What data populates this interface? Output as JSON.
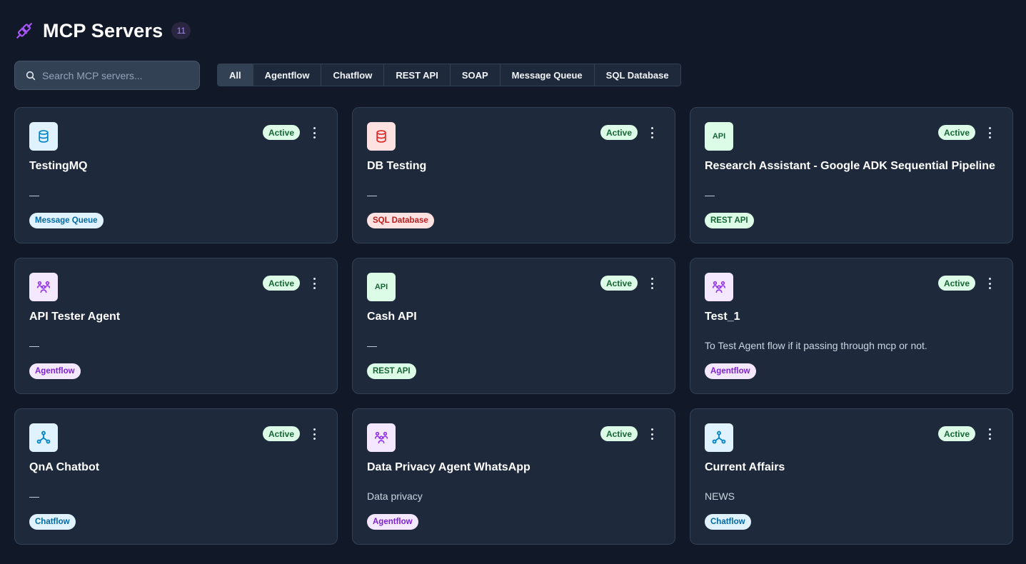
{
  "header": {
    "title": "MCP Servers",
    "count": "11",
    "logo_icon": "plug-icon"
  },
  "search": {
    "placeholder": "Search MCP servers...",
    "value": ""
  },
  "filters": [
    "All",
    "Agentflow",
    "Chatflow",
    "REST API",
    "SOAP",
    "Message Queue",
    "SQL Database"
  ],
  "active_filter": "All",
  "cards": [
    {
      "title": "TestingMQ",
      "desc": "—",
      "tag": "Message Queue",
      "status": "Active",
      "kind": "mq",
      "icon": "database-icon"
    },
    {
      "title": "DB Testing",
      "desc": "—",
      "tag": "SQL Database",
      "status": "Active",
      "kind": "sql",
      "icon": "database-icon"
    },
    {
      "title": "Research Assistant - Google ADK Sequential Pipeline",
      "desc": "—",
      "tag": "REST API",
      "status": "Active",
      "kind": "api",
      "icon": "api-icon",
      "icon_text": "API"
    },
    {
      "title": "API Tester Agent",
      "desc": "—",
      "tag": "Agentflow",
      "status": "Active",
      "kind": "agent",
      "icon": "users-icon"
    },
    {
      "title": "Cash API",
      "desc": "—",
      "tag": "REST API",
      "status": "Active",
      "kind": "api",
      "icon": "api-icon",
      "icon_text": "API"
    },
    {
      "title": "Test_1",
      "desc": "To Test Agent flow if it passing through mcp or not.",
      "tag": "Agentflow",
      "status": "Active",
      "kind": "agent",
      "icon": "users-icon"
    },
    {
      "title": "QnA Chatbot",
      "desc": "—",
      "tag": "Chatflow",
      "status": "Active",
      "kind": "chat",
      "icon": "flow-nodes-icon"
    },
    {
      "title": "Data Privacy Agent WhatsApp",
      "desc": "Data privacy",
      "tag": "Agentflow",
      "status": "Active",
      "kind": "agent",
      "icon": "users-icon"
    },
    {
      "title": "Current Affairs",
      "desc": "NEWS",
      "tag": "Chatflow",
      "status": "Active",
      "kind": "chat",
      "icon": "flow-nodes-icon"
    }
  ],
  "colors": {
    "background": "#111827",
    "card": "#1e293b",
    "accent_purple": "#a855f7",
    "status_active_bg": "#dcfce7",
    "status_active_fg": "#166534"
  }
}
